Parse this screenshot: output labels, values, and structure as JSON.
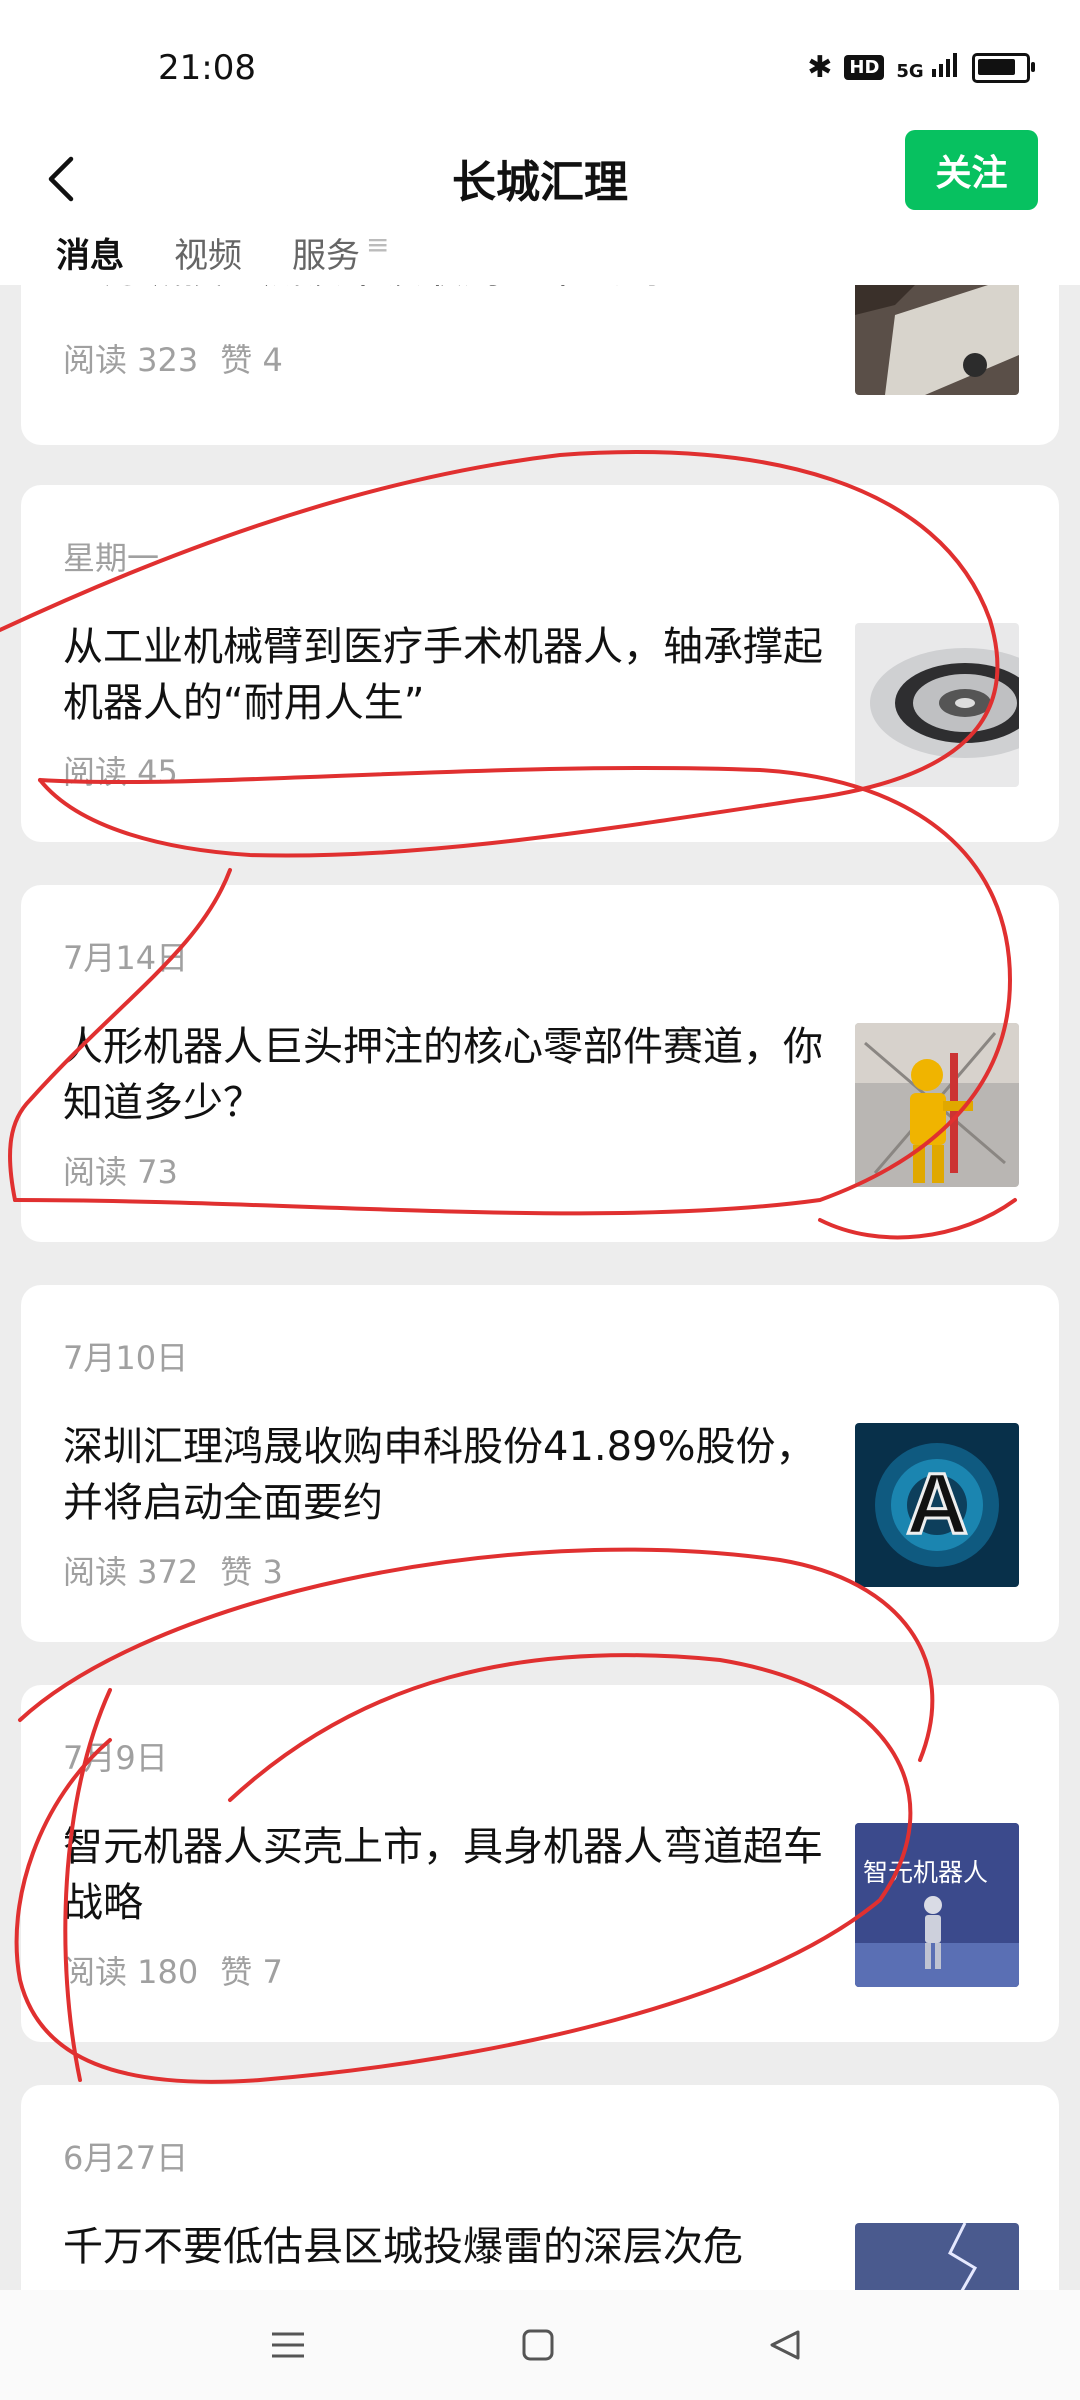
{
  "status": {
    "time": "21:08",
    "hd": "HD",
    "network": "5G",
    "battery_level": 0.8
  },
  "header": {
    "title": "长城汇理",
    "follow_label": "关注"
  },
  "tabs": [
    {
      "label": "消息",
      "active": true
    },
    {
      "label": "视频",
      "active": false
    },
    {
      "label": "服务",
      "active": false
    }
  ],
  "tab_more": "≡",
  "articles": [
    {
      "title": "地方城投到底该不该收购上市公司？",
      "reads": "阅读 323",
      "likes": "赞 4"
    },
    {
      "date": "星期一",
      "title": "从工业机械臂到医疗手术机器人，轴承撑起机器人的“耐用人生”",
      "reads": "阅读 45"
    },
    {
      "date": "7月14日",
      "title": "人形机器人巨头押注的核心零部件赛道，你知道多少？",
      "reads": "阅读 73"
    },
    {
      "date": "7月10日",
      "title": "深圳汇理鸿晟收购申科股份41.89%股份，并将启动全面要约",
      "reads": "阅读 372",
      "likes": "赞 3"
    },
    {
      "date": "7月9日",
      "title": "智元机器人买壳上市，具身机器人弯道超车战略",
      "reads": "阅读 180",
      "likes": "赞 7",
      "thumb_text": "智元机器人"
    },
    {
      "date": "6月27日",
      "title": "千万不要低估县区城投爆雷的深层次危"
    }
  ]
}
